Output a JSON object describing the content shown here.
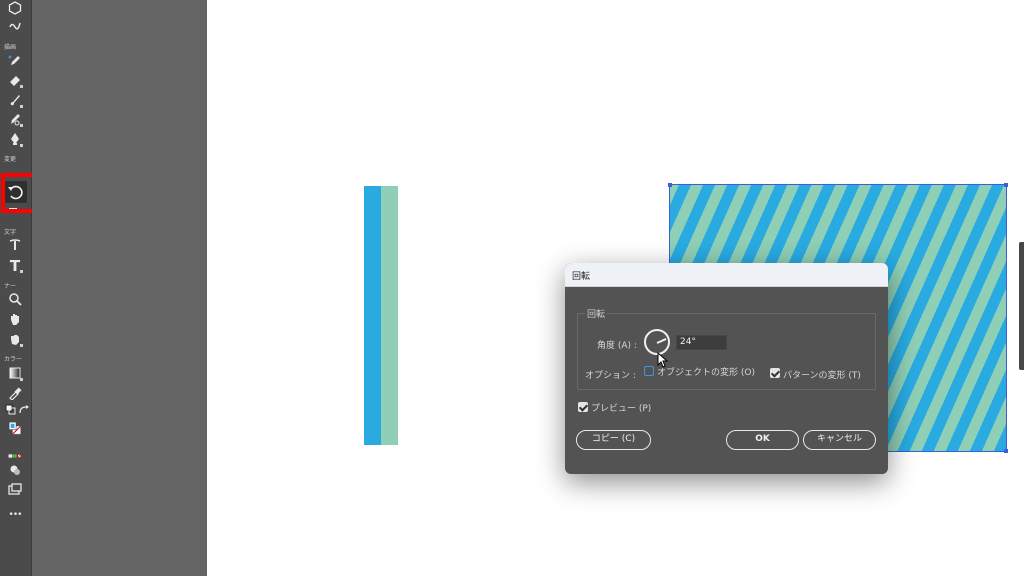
{
  "toolbar": {
    "group_labels": {
      "draw": "描画",
      "modify": "変更",
      "type": "文字",
      "navigate": "ナー",
      "color": "カラー"
    },
    "tools": [
      {
        "name": "polygon-icon"
      },
      {
        "name": "shaper-icon"
      },
      {
        "name": "pencil-icon"
      },
      {
        "name": "eraser-icon"
      },
      {
        "name": "brush-icon"
      },
      {
        "name": "blob-brush-icon"
      },
      {
        "name": "pen-icon"
      },
      {
        "name": "rotate-icon",
        "selected": true
      },
      {
        "name": "width-icon"
      },
      {
        "name": "type-on-path-icon"
      },
      {
        "name": "type-icon"
      },
      {
        "name": "zoom-icon"
      },
      {
        "name": "hand-icon"
      },
      {
        "name": "print-tiling-icon"
      },
      {
        "name": "gradient-icon"
      },
      {
        "name": "eyedropper-icon"
      },
      {
        "name": "default-colors-icon"
      },
      {
        "name": "swap-colors-icon"
      },
      {
        "name": "fill-stroke-icon"
      },
      {
        "name": "color-mode-icon"
      },
      {
        "name": "draw-mode-icon"
      },
      {
        "name": "screen-mode-icon"
      },
      {
        "name": "more-tools-icon"
      }
    ],
    "more_label": "•••",
    "highlight_color": "#ff0000"
  },
  "canvas": {
    "stripe_colors": {
      "blue": "#29abe2",
      "green": "#8fcfb6"
    }
  },
  "dialog": {
    "title": "回転",
    "group_label": "回転",
    "angle_label": "角度 (A) :",
    "angle_value": "24°",
    "options_label": "オプション :",
    "transform_objects_label": "オブジェクトの変形 (O)",
    "transform_objects_checked": false,
    "transform_patterns_label": "パターンの変形 (T)",
    "transform_patterns_checked": true,
    "preview_label": "プレビュー (P)",
    "preview_checked": true,
    "copy_button": "コピー (C)",
    "ok_button": "OK",
    "cancel_button": "キャンセル"
  }
}
